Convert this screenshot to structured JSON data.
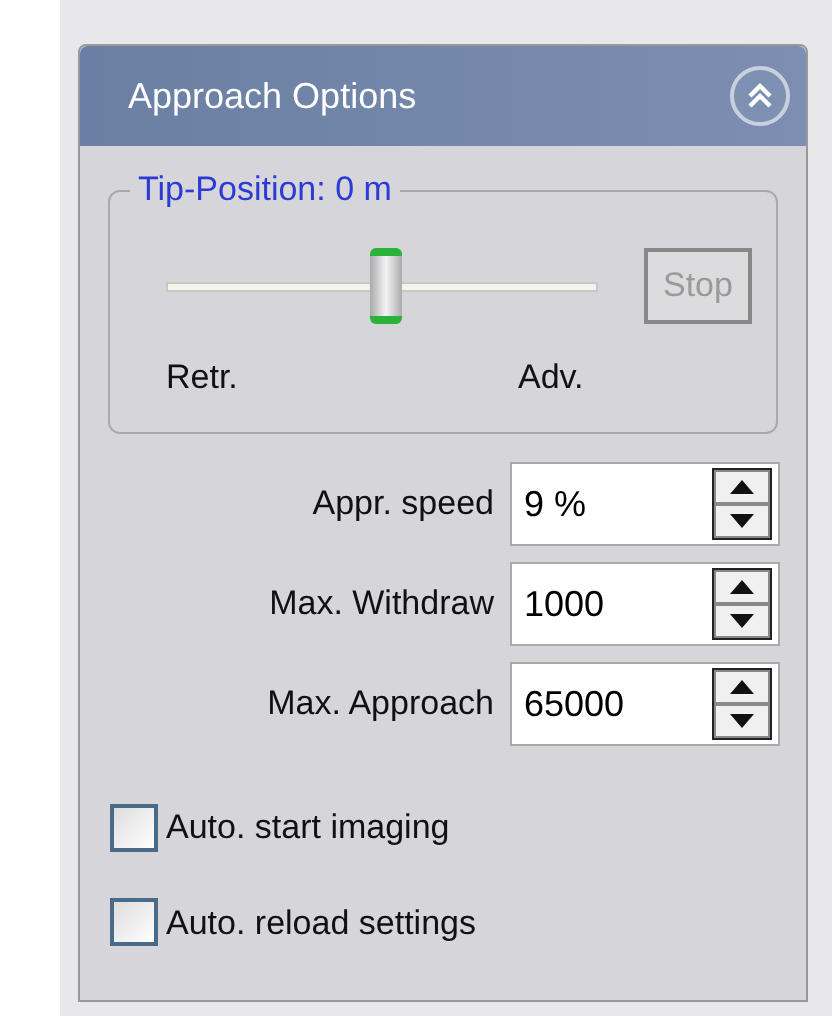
{
  "panel": {
    "title": "Approach Options"
  },
  "tip_position": {
    "legend": "Tip-Position: 0 m",
    "level": 0.51,
    "left_label": "Retr.",
    "right_label": "Adv.",
    "stop_button": {
      "label": "Stop",
      "disabled": true
    }
  },
  "fields": [
    {
      "label": "Appr. speed",
      "value": "9 %"
    },
    {
      "label": "Max. Withdraw",
      "value": "1000"
    },
    {
      "label": "Max. Approach",
      "value": "65000"
    }
  ],
  "checkboxes": [
    {
      "label": "Auto. start imaging",
      "checked": false
    },
    {
      "label": "Auto. reload settings",
      "checked": false
    }
  ]
}
